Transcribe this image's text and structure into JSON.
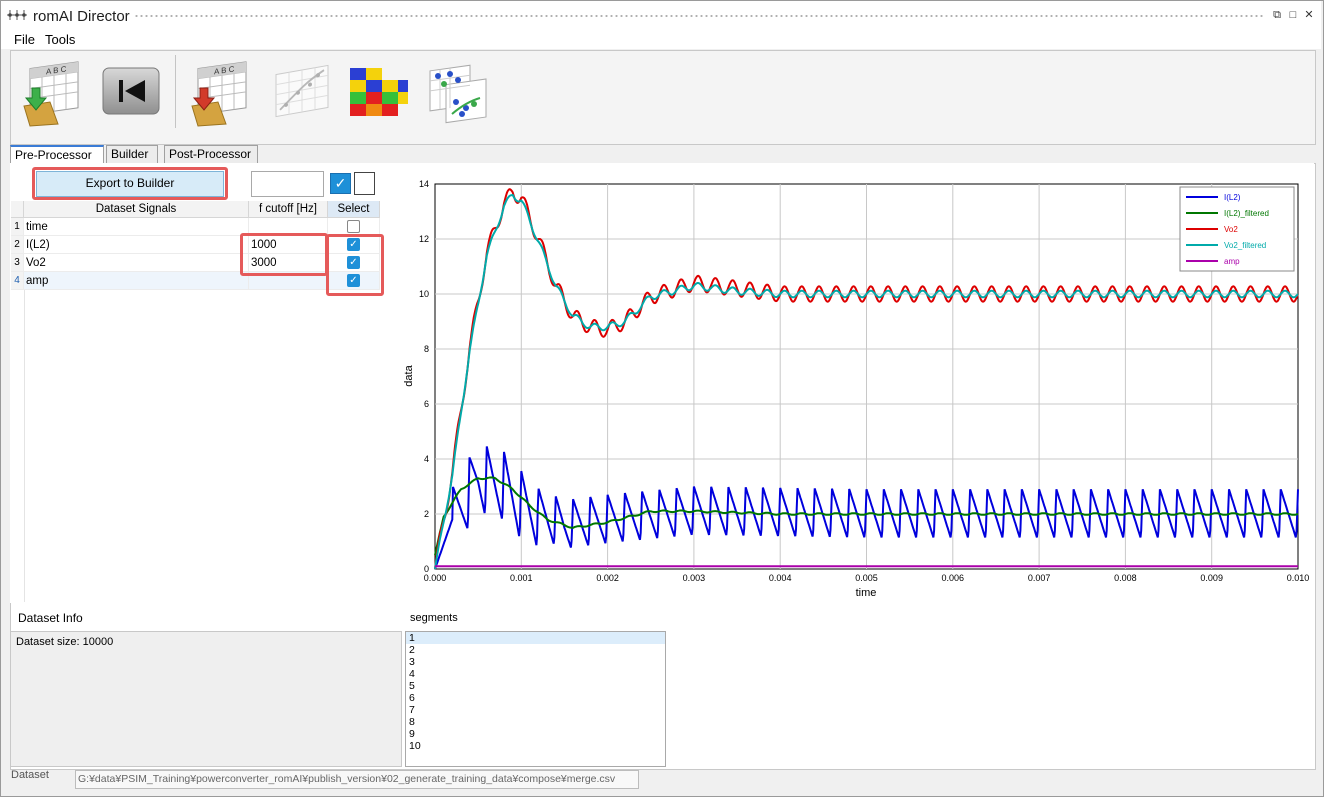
{
  "window": {
    "title": "romAI Director"
  },
  "menu": {
    "file": "File",
    "tools": "Tools"
  },
  "toolbar": {
    "icons": [
      "import-data-icon",
      "rewind-icon",
      "export-data-icon",
      "scatter-plot-icon",
      "heatmap-icon",
      "cluster-plot-icon"
    ]
  },
  "tabs": [
    "Pre-Processor",
    "Builder",
    "Post-Processor"
  ],
  "preprocessor": {
    "export_label": "Export to Builder",
    "cutoff_input": "",
    "columns": {
      "signals": "Dataset Signals",
      "cutoff": "f cutoff [Hz]",
      "select": "Select"
    },
    "rows": [
      {
        "num": "1",
        "name": "time",
        "cutoff": "",
        "selected": false
      },
      {
        "num": "2",
        "name": "I(L2)",
        "cutoff": "1000",
        "selected": true
      },
      {
        "num": "3",
        "name": "Vo2",
        "cutoff": "3000",
        "selected": true
      },
      {
        "num": "4",
        "name": "amp",
        "cutoff": "",
        "selected": true
      }
    ]
  },
  "chart_data": {
    "type": "line",
    "xlabel": "time",
    "ylabel": "data",
    "xlim": [
      0,
      0.01
    ],
    "ylim": [
      0,
      14
    ],
    "xticks": [
      "0.000",
      "0.001",
      "0.002",
      "0.003",
      "0.004",
      "0.005",
      "0.006",
      "0.007",
      "0.008",
      "0.009",
      "0.010"
    ],
    "yticks": [
      "0",
      "2",
      "4",
      "6",
      "8",
      "10",
      "12",
      "14"
    ],
    "grid": true,
    "legend_position": "top-right",
    "series": [
      {
        "name": "I(L2)",
        "color": "#0000dd",
        "kind": "sawtooth",
        "envelope_x": [
          0,
          0.0002,
          0.0005,
          0.0008,
          0.001,
          0.0015,
          0.002,
          0.003,
          0.005,
          0.01
        ],
        "envelope_y": [
          0,
          1.8,
          3.3,
          3.0,
          2.3,
          1.6,
          1.8,
          2.1,
          2.0,
          2.0
        ],
        "ripple": 0.9,
        "period": 0.0002
      },
      {
        "name": "I(L2)_filtered",
        "color": "#007700",
        "kind": "smooth",
        "x": [
          0,
          0.0001,
          0.0002,
          0.0003,
          0.0005,
          0.0007,
          0.0009,
          0.0011,
          0.0013,
          0.0016,
          0.002,
          0.0025,
          0.003,
          0.004,
          0.005,
          0.01
        ],
        "y": [
          0.5,
          1.9,
          2.4,
          2.9,
          3.3,
          3.3,
          2.9,
          2.3,
          1.8,
          1.5,
          1.7,
          2.1,
          2.1,
          2.0,
          2.0,
          2.0
        ],
        "ripple": 0.03,
        "period": 0.0002
      },
      {
        "name": "Vo2",
        "color": "#dd0000",
        "kind": "smooth",
        "x": [
          0,
          0.0002,
          0.0004,
          0.0006,
          0.0008,
          0.0009,
          0.001,
          0.0012,
          0.0014,
          0.0016,
          0.0018,
          0.002,
          0.0022,
          0.0025,
          0.003,
          0.0035,
          0.004,
          0.005,
          0.01
        ],
        "y": [
          0,
          3.5,
          8.0,
          11.5,
          13.3,
          13.7,
          13.5,
          12.0,
          10.3,
          9.2,
          8.8,
          8.7,
          9.0,
          9.9,
          10.4,
          10.2,
          10.0,
          10.0,
          10.0
        ],
        "ripple": 0.28,
        "period": 0.0002
      },
      {
        "name": "Vo2_filtered",
        "color": "#00aaaa",
        "kind": "smooth",
        "x": [
          0,
          0.0002,
          0.0004,
          0.0006,
          0.0008,
          0.0009,
          0.001,
          0.0012,
          0.0014,
          0.0016,
          0.0018,
          0.002,
          0.0022,
          0.0025,
          0.003,
          0.0035,
          0.004,
          0.005,
          0.01
        ],
        "y": [
          0,
          3.4,
          7.9,
          11.4,
          13.2,
          13.6,
          13.4,
          11.9,
          10.3,
          9.2,
          8.8,
          8.8,
          9.0,
          9.9,
          10.3,
          10.1,
          10.0,
          10.0,
          10.0
        ],
        "ripple": 0.12,
        "period": 0.0002
      },
      {
        "name": "amp",
        "color": "#aa00aa",
        "kind": "smooth",
        "x": [
          0,
          0.01
        ],
        "y": [
          0.1,
          0.1
        ],
        "ripple": 0,
        "period": 0.0002
      }
    ]
  },
  "dataset_info": {
    "title": "Dataset Info",
    "size_text": "Dataset size: 10000"
  },
  "segments": {
    "title": "segments",
    "items": [
      "1",
      "2",
      "3",
      "4",
      "5",
      "6",
      "7",
      "8",
      "9",
      "10"
    ]
  },
  "footer": {
    "label": "Dataset",
    "path": "G:¥data¥PSIM_Training¥powerconverter_romAI¥publish_version¥02_generate_training_data¥compose¥merge.csv"
  }
}
